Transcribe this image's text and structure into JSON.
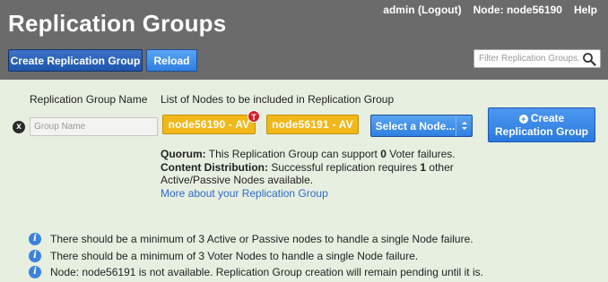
{
  "header": {
    "title": "Replication Groups",
    "user_link": "admin (Logout)",
    "node_label": "Node: node56190",
    "help_link": "Help"
  },
  "toolbar": {
    "create_button": "Create Replication Group",
    "reload_button": "Reload",
    "filter_placeholder": "Filter Replication Groups..."
  },
  "form": {
    "col_name_header": "Replication Group Name",
    "col_nodes_header": "List of Nodes to be included in Replication Group",
    "group_name_placeholder": "Group Name",
    "remove_icon": "x",
    "nodes": [
      {
        "label": "node56190 - AV",
        "badge": "T"
      },
      {
        "label": "node56191 - AV"
      }
    ],
    "node_select_label": "Select a Node...",
    "create_button_line1": "Create",
    "create_button_line2": "Replication Group",
    "quorum": {
      "label": "Quorum:",
      "text_before": " This Replication Group can support ",
      "count": "0",
      "text_after": " Voter failures."
    },
    "distribution": {
      "label": "Content Distribution:",
      "text_before": " Successful replication requires ",
      "count": "1",
      "text_after": " other",
      "line2": "Active/Passive Nodes available."
    },
    "more_link": "More about your Replication Group"
  },
  "notes": [
    "There should be a minimum of 3 Active or Passive nodes to handle a single Node failure.",
    "There should be a minimum of 3 Voter Nodes to handle a single Node failure.",
    "Node: node56191 is not available. Replication Group creation will remain pending until it is."
  ],
  "colors": {
    "header_bg": "#6b6b6b",
    "body_bg": "#e6efe0",
    "button_blue": "#2f7fe0",
    "node_chip": "#f0b81a",
    "badge_red": "#d4202c",
    "link": "#2f6bc9"
  }
}
